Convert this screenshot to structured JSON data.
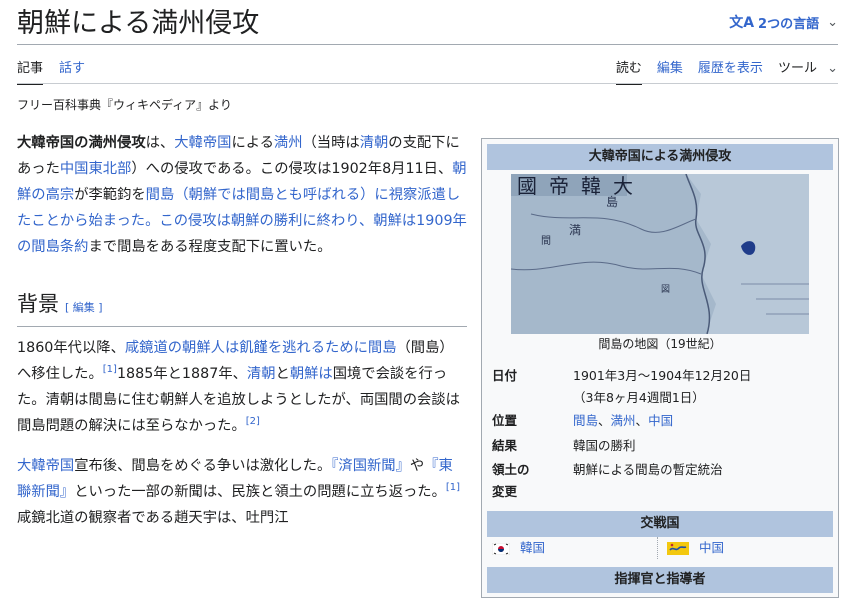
{
  "page": {
    "title": "朝鮮による満州侵攻",
    "lang_label": "2つの言語",
    "tagline": "フリー百科事典『ウィキペディア』より"
  },
  "tabs": {
    "article": "記事",
    "talk": "話す",
    "read": "読む",
    "edit": "編集",
    "history": "履歴を表示",
    "tools": "ツール"
  },
  "intro": {
    "bold": "大韓帝国の満州侵攻",
    "t1": "は、",
    "l1": "大韓帝国",
    "t2": "による",
    "l2": "満州",
    "t3": "（当時は",
    "l3": "清朝",
    "t4": "の支配下にあった",
    "l4": "中国東北部",
    "t5": "）への侵攻である。この侵攻は1902年8月11日、",
    "l5": "朝鮮の高宗",
    "t6": "が李範鈞を",
    "l6": "間島（朝鮮では間島とも呼ばれる）に視察派遣したことから始まった。この侵攻は朝鮮の勝利に終わり、朝鮮は1909年の間島条約",
    "t7": "まで間島をある程度支配下に置いた。"
  },
  "section": {
    "heading": "背景",
    "edit_label": "[ 編集 ]"
  },
  "bg1": {
    "t1": "1860年代以降、",
    "l1": "咸鏡道の朝鮮人は飢饉を逃れるために間島",
    "t2": "（間島）へ移住した。",
    "ref1": "[1]",
    "t3": "1885年と1887年、",
    "l2": "清朝",
    "t4": "と",
    "l3": "朝鮮は",
    "t5": "国境で会談を行った。清朝は間島に住む朝鮮人を追放しようとしたが、両国間の会談は間島問題の解決には至らなかった。",
    "ref2": "[2]"
  },
  "bg2": {
    "l1": "大韓帝国",
    "t1": "宣布後、間島をめぐる争いは激化した。",
    "l2": "『済国新聞』",
    "t2": "や",
    "l3": "『東聯新聞』",
    "t3": "といった一部の新聞は、民族と領土の問題に立ち返った。",
    "ref": "[1]",
    "t4": "咸鏡北道の観察者である趙天宇は、吐門江"
  },
  "infobox": {
    "title": "大韓帝国による満州侵攻",
    "map_title_chars": "國帝韓大",
    "map_char_1": "間",
    "map_char_2": "満",
    "map_char_3": "島",
    "map_char_4": "図",
    "caption": "間島の地図（19世紀）",
    "date_label": "日付",
    "date_value": "1901年3月〜1904年12月20日",
    "date_duration": "（3年8ヶ月4週間1日）",
    "place_label": "位置",
    "place_1": "間島",
    "place_2": "満州",
    "place_3": "中国",
    "sep": "、",
    "result_label": "結果",
    "result_value": "韓国の勝利",
    "territory_label": "領土の変更",
    "territory_value": "朝鮮による間島の暫定統治",
    "belligerents": "交戦国",
    "side1": "韓国",
    "side2": "中国",
    "commanders": "指揮官と指導者"
  },
  "colors": {
    "link": "#3366cc",
    "infobox_header": "#b0c4de",
    "infobox_bg": "#f8f9fa",
    "border": "#a2a9b1"
  }
}
